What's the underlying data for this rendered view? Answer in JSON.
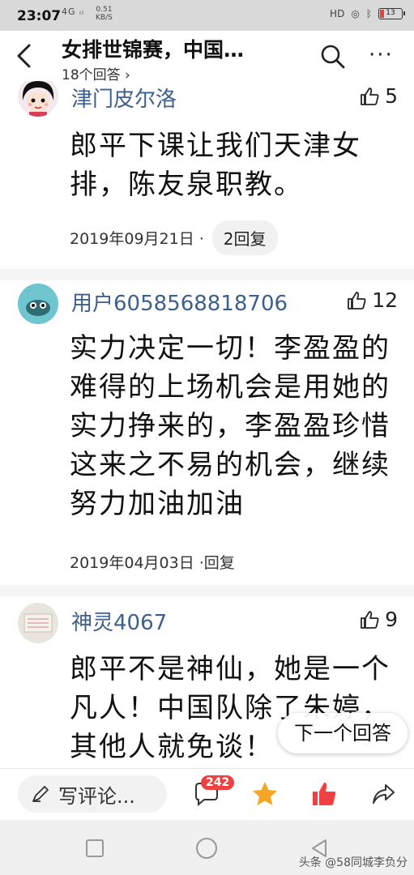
{
  "status_bar": {
    "time": "23:07",
    "network": "4G ᵢₗ",
    "speed_value": "0.51",
    "speed_unit": "KB/S",
    "right_label": "HD",
    "battery": "13"
  },
  "header": {
    "title": "女排世锦赛，中国…",
    "subtitle": "18个回答 ›"
  },
  "answers": [
    {
      "user": "津门皮尔洛",
      "likes": "5",
      "text": "郎平下课让我们天津女排，陈友泉职教。",
      "date": "2019年09月21日 ·",
      "reply": "2回复"
    },
    {
      "user": "用户6058568818706",
      "likes": "12",
      "text": "实力决定一切！李盈盈的难得的上场机会是用她的实力挣来的，李盈盈珍惜这来之不易的机会，继续努力加油加油",
      "date": "2019年04月03日 ·",
      "reply": "回复"
    },
    {
      "user": "神灵4067",
      "likes": "9",
      "text": "郎平不是神仙，她是一个凡人！中国队除了朱婷，其他人就免谈！"
    }
  ],
  "next_button": "下一个回答",
  "toolbar": {
    "comment_placeholder": "写评论...",
    "comment_count": "242"
  },
  "watermark": "头条 @58同城李负分",
  "colors": {
    "username": "#3d5f8c",
    "badge": "#f04142",
    "star": "#f5a623",
    "like_active": "#f04142"
  }
}
